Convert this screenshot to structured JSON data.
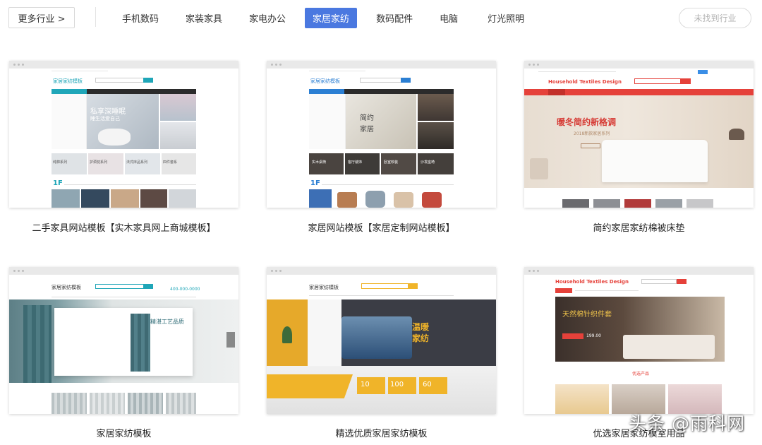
{
  "filter_bar": {
    "more_label": "更多行业 >",
    "categories": [
      "手机数码",
      "家装家具",
      "家电办公",
      "家居家纺",
      "数码配件",
      "电脑",
      "灯光照明"
    ],
    "active_category": "家居家纺",
    "not_found_label": "未找到行业",
    "accent_color": "#4a78e0"
  },
  "templates": [
    {
      "caption": "二手家具网站模板【实木家具网上商城模板】",
      "logo": "家居家纺模板",
      "banner_line1": "私享深睡眠",
      "banner_line2": "睡生活爱自己",
      "floor_label": "1F",
      "tiles": [
        "纯棉系列",
        "护颈枕系列",
        "法式床品系列",
        "四件套系"
      ],
      "theme_color": "#1fa6b8"
    },
    {
      "caption": "家居网站模板【家居定制网站模板】",
      "logo": "家居家纺模板",
      "banner_line1": "简约",
      "banner_line2": "家居",
      "floor_label": "1F",
      "tiles": [
        "实木桌椅",
        "客厅装饰",
        "卧室软装",
        "沙发座椅"
      ],
      "theme_color": "#2b7fd3"
    },
    {
      "caption": "简约家居家纺棉被床垫",
      "logo": "Household Textiles Design",
      "banner_line1": "暖冬简约新格调",
      "banner_line2": "2018新款家居系列",
      "theme_color": "#e5413a"
    },
    {
      "caption": "家居家纺模板",
      "logo": "家居家纺模板",
      "phone": "400-000-0000",
      "banner_line1": "精湛工艺品质",
      "theme_color": "#1fa6b8"
    },
    {
      "caption": "精选优质家居家纺模板",
      "logo": "家居家纺模板",
      "banner_line1": "温暖",
      "banner_line2": "家纺",
      "badges": [
        "10",
        "100",
        "60"
      ],
      "theme_color": "#f0b429"
    },
    {
      "caption": "优选家居家纺模室用品",
      "logo": "Household Textiles Design",
      "banner_line1": "天然棉针织件套",
      "banner_price": "199.00",
      "section_title": "优选产品",
      "theme_color": "#e5413a"
    }
  ],
  "watermark": "头条 @雨科网"
}
